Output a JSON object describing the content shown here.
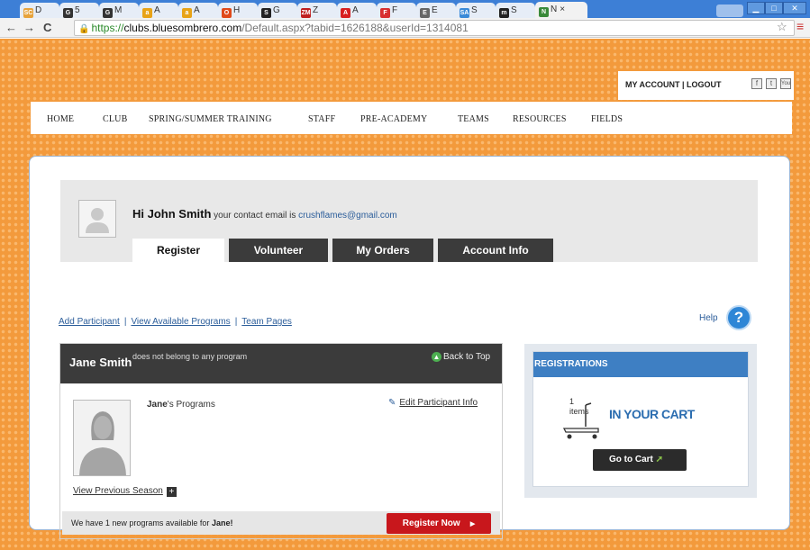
{
  "browser": {
    "tabs": [
      {
        "label": "D",
        "fav": "SCN",
        "color": "#e7a33c"
      },
      {
        "label": "5",
        "fav": "G",
        "color": "#333333"
      },
      {
        "label": "M",
        "fav": "G",
        "color": "#333333"
      },
      {
        "label": "A",
        "fav": "a",
        "color": "#e8a317"
      },
      {
        "label": "A",
        "fav": "a",
        "color": "#e8a317"
      },
      {
        "label": "H",
        "fav": "O",
        "color": "#e04a1a"
      },
      {
        "label": "G",
        "fav": "S",
        "color": "#222222"
      },
      {
        "label": "Z",
        "fav": "ZM",
        "color": "#c02020"
      },
      {
        "label": "A",
        "fav": "A",
        "color": "#d82020"
      },
      {
        "label": "F",
        "fav": "F",
        "color": "#d83030"
      },
      {
        "label": "E",
        "fav": "E",
        "color": "#666666"
      },
      {
        "label": "S",
        "fav": "SAP",
        "color": "#3a8ad8"
      },
      {
        "label": "S",
        "fav": "m",
        "color": "#222222"
      },
      {
        "label": "N",
        "fav": "N",
        "color": "#3a8a3a"
      }
    ],
    "url_scheme": "https://",
    "url_host": "clubs.bluesombrero.com",
    "url_path": "/Default.aspx?tabid=1626188&userId=1314081",
    "tab_close": "×"
  },
  "header": {
    "account_links": "MY ACCOUNT | LOGOUT",
    "social": [
      "f",
      "t",
      "You"
    ]
  },
  "nav": {
    "items": [
      "HOME",
      "CLUB",
      "SPRING/SUMMER TRAINING",
      "STAFF",
      "PRE-ACADEMY",
      "TEAMS",
      "RESOURCES",
      "FIELDS"
    ]
  },
  "profile": {
    "greeting": "Hi John Smith",
    "email_prefix": "your contact email is",
    "email": "crushflames@gmail.com",
    "tabs": [
      "Register",
      "Volunteer",
      "My Orders",
      "Account Info"
    ]
  },
  "links": {
    "add_participant": "Add Participant",
    "view_programs": "View Available Programs",
    "team_pages": "Team Pages",
    "separator": "|",
    "help": "Help",
    "help_icon": "?"
  },
  "participant": {
    "name": "Jane Smith",
    "note": "does not belong to any program",
    "back_to_top": "Back to Top",
    "programs_name": "Jane",
    "programs_suffix": "'s Programs",
    "edit": "Edit Participant Info",
    "view_previous": "View Previous Season",
    "available_prefix": "We have 1 new programs available for",
    "available_name": "Jane!",
    "register_now": "Register Now",
    "register_arrow": "▶"
  },
  "registrations": {
    "title": "REGISTRATIONS",
    "count": "1",
    "items_label": "items",
    "in_cart": "IN YOUR CART",
    "go_to_cart": "Go to Cart"
  }
}
